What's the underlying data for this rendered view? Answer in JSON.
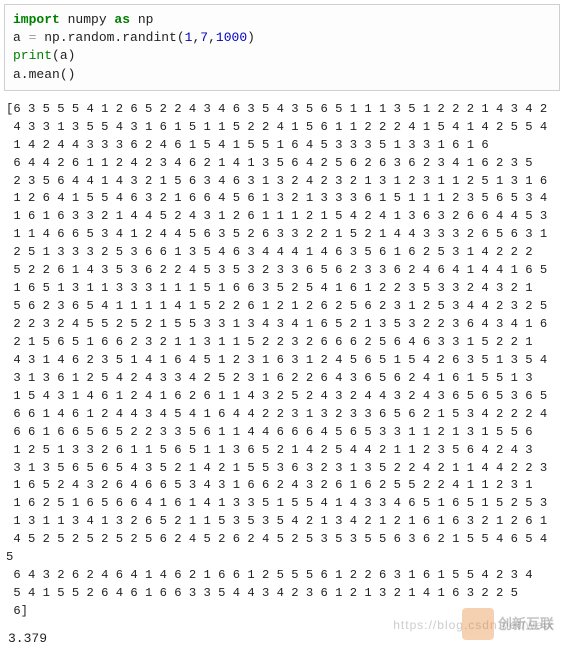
{
  "code": {
    "line1_import": "import",
    "line1_lib": " numpy ",
    "line1_as": "as",
    "line1_alias": " np",
    "line2_lhs": "a ",
    "line2_eq": "=",
    "line2_call": " np.random.randint",
    "line2_paren_open": "(",
    "line2_arg1": "1",
    "line2_comma1": ",",
    "line2_arg2": "7",
    "line2_comma2": ",",
    "line2_arg3": "1000",
    "line2_paren_close": ")",
    "line3_print": "print",
    "line3_po": "(",
    "line3_arg": "a",
    "line3_pc": ")",
    "line4_call": "a.mean",
    "line4_po": "()",
    "line4_pc": ""
  },
  "array_rows": [
    "[6 3 5 5 5 4 1 2 6 5 2 2 4 3 4 6 3 5 4 3 5 6 5 1 1 1 3 5 1 2 2 2 1 4 3 4 2",
    " 4 3 3 1 3 5 5 4 3 1 6 1 5 1 1 5 2 2 4 1 5 6 1 1 2 2 2 4 1 5 4 1 4 2 5 5 4",
    " 1 4 2 4 4 3 3 3 6 2 4 6 1 5 4 1 5 5 1 6 4 5 3 3 3 5 1 3 3 1 6 1 6",
    " 6 4 4 2 6 1 1 2 4 2 3 4 6 2 1 4 1 3 5 6 4 2 5 6 2 6 3 6 2 3 4 1 6 2 3 5",
    " 2 3 5 6 4 4 1 4 3 2 1 5 6 3 4 6 3 1 3 2 4 2 3 2 1 3 1 2 3 1 1 2 5 1 3 1 6",
    " 1 2 6 4 1 5 5 4 6 3 2 1 6 6 4 5 6 1 3 2 1 3 3 3 6 1 5 1 1 1 2 3 5 6 5 3 4",
    " 1 6 1 6 3 3 2 1 4 4 5 2 4 3 1 2 6 1 1 1 2 1 5 4 2 4 1 3 6 3 2 6 6 4 4 5 3",
    " 1 1 4 6 6 5 3 4 1 2 4 4 5 6 3 5 2 6 3 3 2 2 1 5 2 1 4 4 3 3 3 2 6 5 6 3 1",
    " 2 5 1 3 3 3 2 5 3 6 6 1 3 5 4 6 3 4 4 4 1 4 6 3 5 6 1 6 2 5 3 1 4 2 2 2",
    " 5 2 2 6 1 4 3 5 3 6 2 2 4 5 3 5 3 2 3 3 6 5 6 2 3 3 6 2 4 6 4 1 4 4 1 6 5",
    " 1 6 5 1 3 1 1 3 3 3 1 1 1 5 1 6 6 3 5 2 5 4 1 6 1 2 2 3 5 3 3 2 4 3 2 1",
    " 5 6 2 3 6 5 4 1 1 1 1 4 1 5 2 2 6 1 2 1 2 6 2 5 6 2 3 1 2 5 3 4 4 2 3 2 5",
    " 2 2 3 2 4 5 5 2 5 2 1 5 5 3 3 1 3 4 3 4 1 6 5 2 1 3 5 3 2 2 3 6 4 3 4 1 6",
    " 2 1 5 6 5 1 6 6 2 3 2 1 1 3 1 1 5 2 2 3 2 6 6 6 2 5 6 4 6 3 3 1 5 2 2 1",
    " 4 3 1 4 6 2 3 5 1 4 1 6 4 5 1 2 3 1 6 3 1 2 4 5 6 5 1 5 4 2 6 3 5 1 3 5 4",
    " 3 1 3 6 1 2 5 4 2 4 3 3 4 2 5 2 3 1 6 2 2 6 4 3 6 5 6 2 4 1 6 1 5 5 1 3",
    " 1 5 4 3 1 4 6 1 2 4 1 6 2 6 1 1 4 3 2 5 2 4 3 2 4 4 3 2 4 3 6 5 6 5 3 6 5",
    " 6 6 1 4 6 1 2 4 4 3 4 5 4 1 6 4 4 2 2 3 1 3 2 3 3 6 5 6 2 1 5 3 4 2 2 2 4",
    " 6 6 1 6 6 5 6 5 2 2 3 3 5 6 1 1 4 4 6 6 6 4 5 6 5 3 3 1 1 2 1 3 1 5 5 6",
    " 1 2 5 1 3 3 2 6 1 1 5 6 5 1 1 3 6 5 2 1 4 2 5 4 4 2 1 1 2 3 5 6 4 2 4 3",
    " 3 1 3 5 6 5 6 5 4 3 5 2 1 4 2 1 5 5 3 6 3 2 3 1 3 5 2 2 4 2 1 1 4 4 2 2 3",
    " 1 6 5 2 4 3 2 6 4 6 6 5 3 4 3 1 6 6 2 4 3 2 6 1 6 2 5 5 2 2 4 1 1 2 3 1",
    " 1 6 2 5 1 6 5 6 6 4 1 6 1 4 1 3 3 5 1 5 5 4 1 4 3 3 4 6 5 1 6 5 1 5 2 5 3",
    " 1 3 1 1 3 4 1 3 2 6 5 2 1 1 5 3 5 3 5 4 2 1 3 4 2 1 2 1 6 1 6 3 2 1 2 6 1",
    " 4 5 2 5 2 5 2 5 2 5 6 2 4 5 2 6 2 4 5 2 5 3 5 3 5 5 6 3 6 2 1 5 5 4 6 5 4 5",
    " 6 4 3 2 6 2 4 6 4 1 4 6 2 1 6 6 1 2 5 5 5 6 1 2 2 6 3 1 6 1 5 5 4 2 3 4",
    " 5 4 1 5 5 2 6 4 6 1 6 6 3 3 5 4 4 3 4 2 3 6 1 2 1 3 2 1 4 1 6 3 2 2 5",
    " 6]"
  ],
  "mean": "3.379",
  "watermark_text": "https://blog.csdn.net/weix",
  "logo_text": "创新互联"
}
